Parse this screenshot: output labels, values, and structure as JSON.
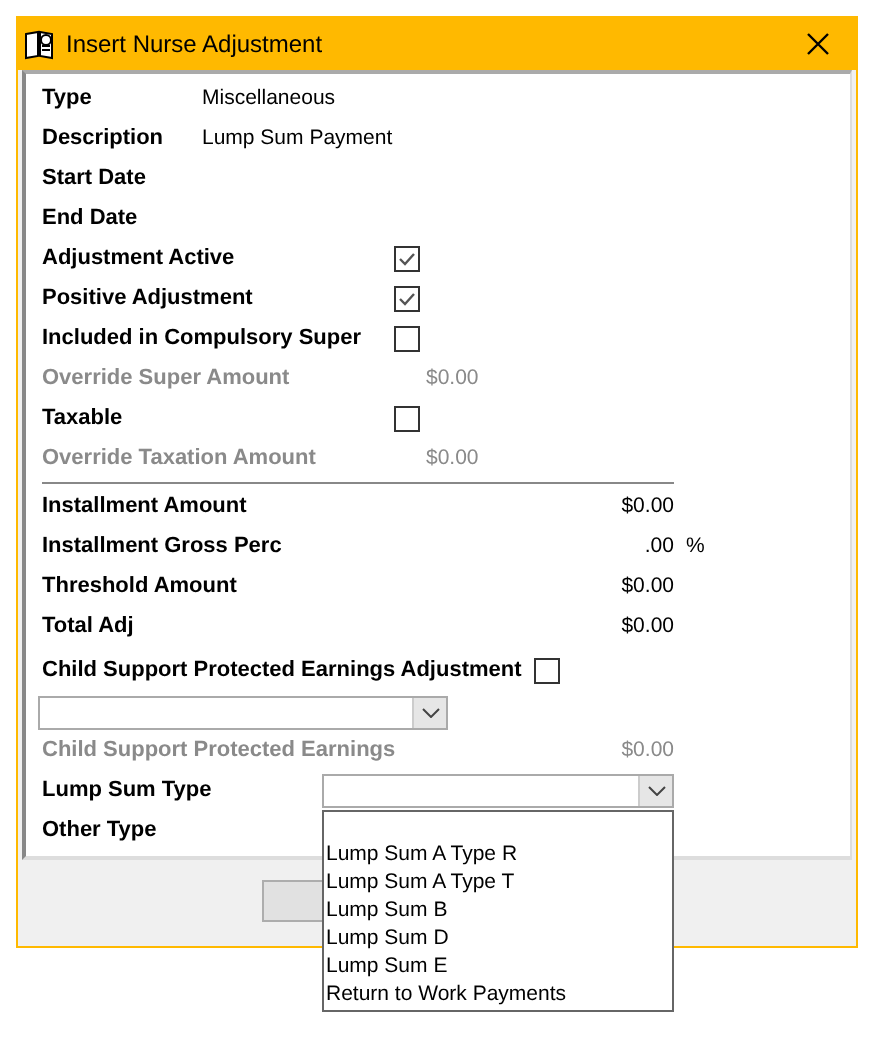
{
  "window": {
    "title": "Insert Nurse Adjustment"
  },
  "sections": [
    {
      "fields": [
        {
          "kind": "text",
          "label": "Type",
          "value": "Miscellaneous"
        },
        {
          "kind": "text",
          "label": "Description",
          "value": "Lump Sum Payment"
        },
        {
          "kind": "text",
          "label": "Start Date"
        },
        {
          "kind": "text",
          "label": "End Date"
        },
        {
          "kind": "checkbox",
          "label": "Adjustment Active",
          "checked": true
        },
        {
          "kind": "checkbox",
          "label": "Positive Adjustment",
          "checked": true
        },
        {
          "kind": "checkbox",
          "label": "Included in Compulsory Super",
          "checked": false
        },
        {
          "kind": "amount",
          "label": "Override Super Amount",
          "value": "$0.00",
          "disabled": true
        },
        {
          "kind": "checkbox",
          "label": "Taxable",
          "checked": false
        },
        {
          "kind": "amount",
          "label": "Override Taxation Amount",
          "value": "$0.00",
          "disabled": true
        }
      ]
    },
    {
      "fields": [
        {
          "kind": "total",
          "label": "Installment Amount",
          "value": "$0.00",
          "disabled": false
        },
        {
          "kind": "total",
          "label": "Installment Gross Perc",
          "value": ".00",
          "suffix": "%",
          "disabled": false
        },
        {
          "kind": "total",
          "label": "Threshold Amount",
          "value": "$0.00",
          "disabled": false
        },
        {
          "kind": "total",
          "label": "Total Adj",
          "value": "$0.00",
          "disabled": false
        },
        {
          "kind": "flag",
          "label": "Child Support Protected Earnings Adjustment",
          "checked": false
        },
        {
          "kind": "select"
        },
        {
          "kind": "total",
          "label": "Child Support Protected Earnings",
          "value": "$0.00",
          "disabled": true
        },
        {
          "kind": "dropdown",
          "label": "Lump Sum Type",
          "options": [
            "Lump Sum A Type R",
            "Lump Sum A Type T",
            "Lump Sum B",
            "Lump Sum D",
            "Lump Sum E",
            "Return to Work Payments"
          ]
        },
        {
          "kind": "label",
          "label": "Other Type"
        }
      ]
    }
  ]
}
